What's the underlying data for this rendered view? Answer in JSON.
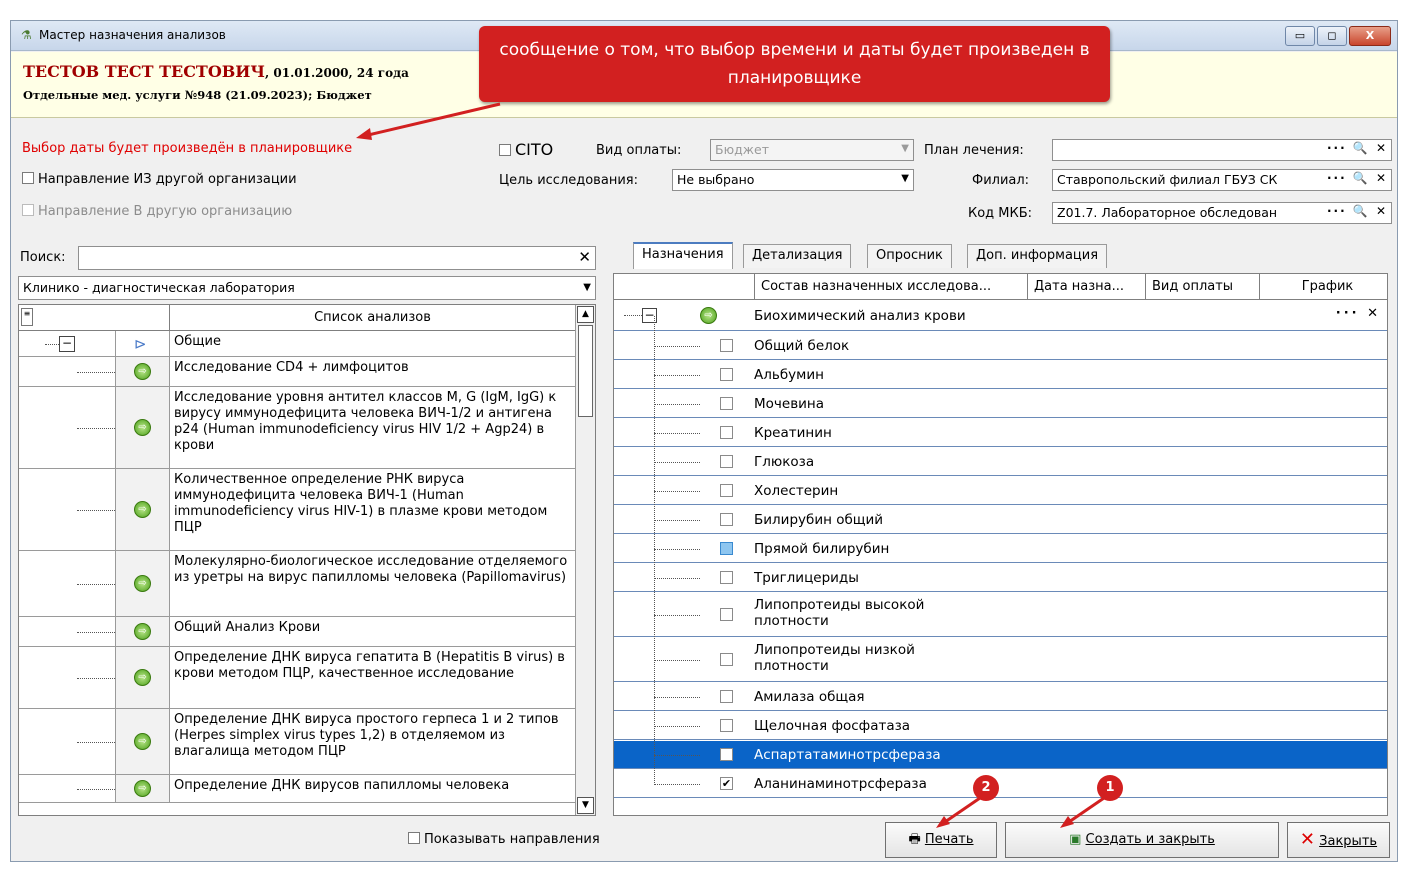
{
  "window": {
    "title": "Мастер назначения анализов",
    "buttons": [
      "▭",
      "◻",
      "X"
    ]
  },
  "patient": {
    "name": "ТЕСТОВ ТЕСТ ТЕСТОВИЧ",
    "dob": ", 01.01.2000, 24 года",
    "info": "Отдельные мед. услуги №948 (21.09.2023); Бюджет"
  },
  "callout": "сообщение о том, что выбор времени и даты будет произведен в планировщике",
  "form": {
    "planner_note": "Выбор даты будет произведён в планировщике",
    "cito_label": "CITO",
    "from_org_label": "Направление ИЗ другой организации",
    "to_org_label": "Направление В другую организацию",
    "payment_label": "Вид оплаты:",
    "payment_value": "Бюджет",
    "purpose_label": "Цель исследования:",
    "purpose_value": "Не выбрано",
    "plan_label": "План лечения:",
    "plan_value": "",
    "branch_label": "Филиал:",
    "branch_value": "Ставропольский филиал ГБУЗ СК",
    "mkb_label": "Код МКБ:",
    "mkb_value": "Z01.7. Лабораторное обследован",
    "field_buttons": "··· 🔍 ✕"
  },
  "left": {
    "search_label": "Поиск:",
    "search_value": "",
    "lab": "Клинико - диагностическая лаборатория",
    "column": "Список анализов",
    "items": [
      {
        "text": "Общие",
        "kind": "group"
      },
      {
        "text": "Исследование CD4 + лимфоцитов"
      },
      {
        "text": "Исследование уровня антител классов M, G (IgM, IgG) к вирусу иммунодефицита человека ВИЧ-1/2 и антигена p24 (Human immunodeficiency virus HIV 1/2 + Agp24) в крови"
      },
      {
        "text": "Количественное определение РНК вируса иммунодефицита человека ВИЧ-1 (Human immunodeficiency virus HIV-1) в плазме крови методом ПЦР"
      },
      {
        "text": "Молекулярно-биологическое исследование отделяемого из уретры на вирус папилломы человека (Papillomavirus)"
      },
      {
        "text": "Общий Анализ Крови"
      },
      {
        "text": "Определение ДНК вируса гепатита B (Hepatitis B virus) в крови методом ПЦР, качественное исследование"
      },
      {
        "text": "Определение ДНК вируса простого герпеса 1 и 2 типов (Herpes simplex virus types 1,2) в отделяемом из влагалища методом ПЦР"
      },
      {
        "text": "Определение ДНК вирусов папилломы человека"
      }
    ]
  },
  "right": {
    "tabs": [
      "Назначения",
      "Детализация",
      "Опросник",
      "Доп. информация"
    ],
    "columns": [
      "Состав назначенных исследова...",
      "Дата назна...",
      "Вид оплаты",
      "График"
    ],
    "group": "Биохимический анализ крови",
    "items": [
      {
        "text": "Общий белок",
        "state": "unchecked"
      },
      {
        "text": "Альбумин",
        "state": "unchecked"
      },
      {
        "text": "Мочевина",
        "state": "unchecked"
      },
      {
        "text": "Креатинин",
        "state": "unchecked"
      },
      {
        "text": "Глюкоза",
        "state": "unchecked"
      },
      {
        "text": "Холестерин",
        "state": "unchecked"
      },
      {
        "text": "Билирубин общий",
        "state": "unchecked"
      },
      {
        "text": "Прямой билирубин",
        "state": "partial"
      },
      {
        "text": "Триглицериды",
        "state": "unchecked"
      },
      {
        "text": "Липопротеиды высокой плотности",
        "state": "unchecked"
      },
      {
        "text": "Липопротеиды низкой плотности",
        "state": "unchecked"
      },
      {
        "text": "Амилаза общая",
        "state": "unchecked"
      },
      {
        "text": "Щелочная фосфатаза",
        "state": "unchecked"
      },
      {
        "text": "Аспартатаминотрсфераза",
        "state": "unchecked",
        "selected": true
      },
      {
        "text": "Аланинаминотрсфераза",
        "state": "checked"
      }
    ]
  },
  "footer": {
    "show_directions": "Показывать направления",
    "print": "Печать",
    "create_close": "Создать и закрыть",
    "close": "Закрыть",
    "marker_1": "1",
    "marker_2": "2"
  },
  "colors": {
    "callout": "#d22020",
    "selection": "#0a64c8",
    "note": "#e00000"
  }
}
